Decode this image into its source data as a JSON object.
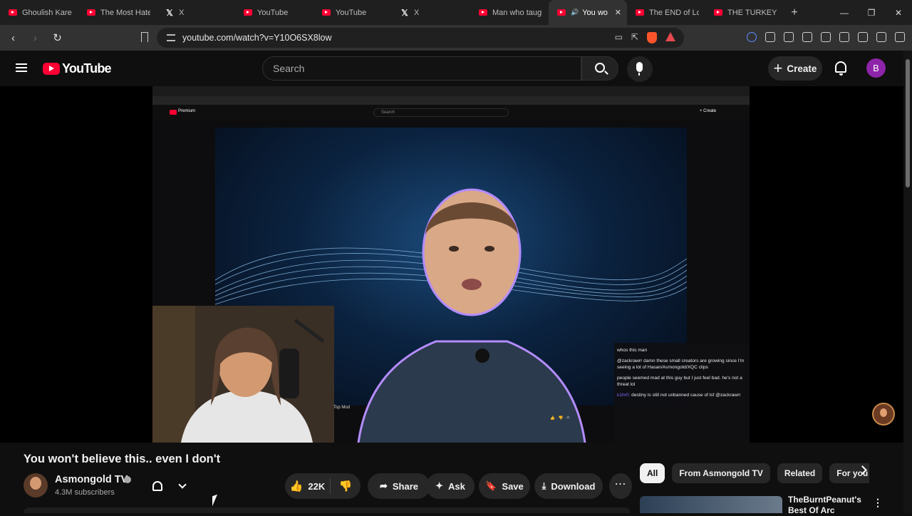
{
  "browser": {
    "tabs": [
      {
        "label": "Ghoulish Karen",
        "type": "youtube"
      },
      {
        "label": "The Most Hated",
        "type": "youtube"
      },
      {
        "label": "X",
        "type": "x"
      },
      {
        "label": "YouTube",
        "type": "youtube"
      },
      {
        "label": "YouTube",
        "type": "youtube"
      },
      {
        "label": "X",
        "type": "x"
      },
      {
        "label": "Man who taught",
        "type": "youtube"
      },
      {
        "label": "You wo",
        "type": "youtube",
        "active": true
      },
      {
        "label": "The END of Lo",
        "type": "youtube"
      },
      {
        "label": "THE TURKEY TO",
        "type": "youtube"
      }
    ],
    "url": "youtube.com/watch?v=Y10O6SX8low"
  },
  "header": {
    "logo_text": "YouTube",
    "search_placeholder": "Search",
    "create_label": "Create",
    "avatar_letter": "B"
  },
  "video_content": {
    "inner_premium": "Premium",
    "inner_search": "Search",
    "inner_create": "+ Create",
    "top_mod": "Top Mod",
    "chat": [
      {
        "user": "",
        "text": "whos this man"
      },
      {
        "user": "",
        "text": "@zackrawrr damn these small creators are growing since I'm seeing a lot of Hasan/Asmongold/XQC clips"
      },
      {
        "user": "",
        "text": "people seemed mad at this guy but I just feel bad. he's not a threat lol"
      },
      {
        "user": "k1hr0:",
        "text": "destiny is still not unbanned cause of lsf @zackrawrr"
      }
    ]
  },
  "video": {
    "title": "You won't believe this.. even I don't",
    "channel": "Asmongold TV",
    "subscribers": "4.3M subscribers",
    "likes": "22K",
    "share_label": "Share",
    "ask_label": "Ask",
    "save_label": "Save",
    "download_label": "Download"
  },
  "chips": [
    "All",
    "From Asmongold TV",
    "Related",
    "For you"
  ],
  "recommendation": {
    "title": "TheBurntPeanut's Best Of Arc"
  },
  "colors": {
    "youtube_red": "#ff0033",
    "avatar_purple": "#8e24aa",
    "page_bg": "#0f0f0f"
  }
}
